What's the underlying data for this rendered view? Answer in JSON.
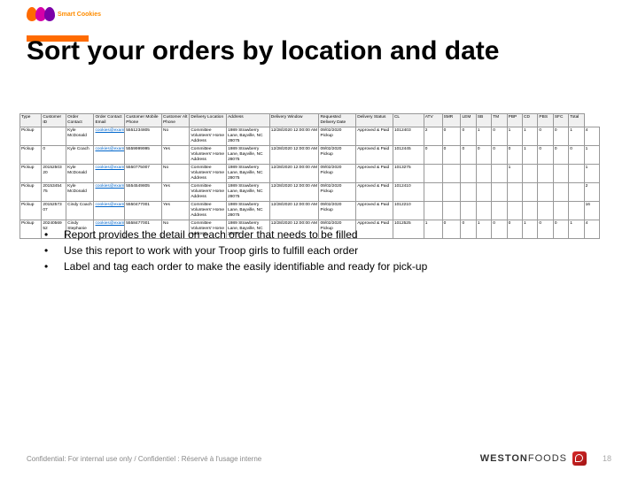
{
  "logo_text": "Smart Cookies",
  "title": "Sort your orders by location and date",
  "table": {
    "headers": [
      "Type",
      "Customer ID",
      "Order Contact",
      "Order Contact Email",
      "Customer Mobile Phone",
      "Customer Alt Phone",
      "Delivery Location",
      "Address",
      "Delivery Window",
      "Requested Delivery Date",
      "Delivery Status",
      "CL",
      "ATV",
      "SMR",
      "LEM",
      "SB",
      "TM",
      "PBP",
      "CD",
      "PBS",
      "SFC",
      "Total"
    ],
    "rows": [
      {
        "c": [
          "Pickup",
          "",
          "Kyle McDonald",
          "cookies@example.com",
          "5551234805",
          "No",
          "Committee Volunteers' Home Address",
          "1989 Strawberry Lane, Bayville, NC 28075",
          "12/28/2020 12:00:00 AM",
          "09/02/2020 Pickup",
          "Approved & Paid",
          "1012403",
          "2",
          "0",
          "0",
          "1",
          "0",
          "1",
          "1",
          "0",
          "0",
          "1",
          "4"
        ]
      },
      {
        "c": [
          "Pickup",
          "0",
          "Kyle Coach",
          "cookies@example.com",
          "5559999995",
          "Yes",
          "Committee Volunteers' Home Address",
          "1989 Strawberry Lane, Bayville, NC 28075",
          "12/28/2020 12:00:00 AM",
          "09/02/2020 Pickup",
          "Approved & Paid",
          "1012445",
          "0",
          "0",
          "0",
          "0",
          "0",
          "0",
          "1",
          "0",
          "0",
          "0",
          "1"
        ]
      },
      {
        "c": [
          "Pickup",
          "20152503 20",
          "Kyle McDonald",
          "cookies@example.com",
          "5550775007",
          "No",
          "Committee Volunteers' Home Address",
          "1989 Strawberry Lane, Bayville, NC 28075",
          "12/28/2020 12:00:00 AM",
          "09/02/2020 Pickup",
          "Approved & Paid",
          "1013275",
          "",
          "",
          "",
          "",
          "",
          "1",
          "",
          "",
          "",
          "",
          "1"
        ]
      },
      {
        "c": [
          "Pickup",
          "20153454 75",
          "Kyle McDonald",
          "cookies@example.com",
          "5554549805",
          "Yes",
          "Committee Volunteers' Home Address",
          "1989 Strawberry Lane, Bayville, NC 28075",
          "12/28/2020 12:00:00 AM",
          "09/02/2020 Pickup",
          "Approved & Paid",
          "1012410",
          "",
          "",
          "",
          "",
          "",
          "",
          "",
          "",
          "",
          "",
          "2"
        ]
      },
      {
        "c": [
          "Pickup",
          "20152573 07",
          "Cindy Coach",
          "cookies@example.com",
          "5550477001",
          "Yes",
          "Committee Volunteers' Home Address",
          "1989 Strawberry Lane, Bayville, NC 28075",
          "12/28/2020 12:00:00 AM",
          "09/02/2020 Pickup",
          "Approved & Paid",
          "1012210",
          "",
          "",
          "",
          "",
          "",
          "",
          "",
          "",
          "",
          "",
          "16"
        ]
      },
      {
        "c": [
          "Pickup",
          "20240569 52",
          "Cindy Stephanie",
          "cookies@example.com",
          "5558477001",
          "No",
          "Committee Volunteers' Home Address",
          "1989 Strawberry Lane, Bayville, NC 28075",
          "12/28/2020 12:00:00 AM",
          "09/02/2020 Pickup",
          "Approved & Paid",
          "1012525",
          "1",
          "0",
          "0",
          "1",
          "0",
          "0",
          "1",
          "0",
          "0",
          "1",
          "4"
        ]
      }
    ]
  },
  "bullets": [
    "Report provides the detail on each order that needs to be filled",
    "Use this report to work with your Troop girls to fulfill each order",
    "Label and tag each order to make the easily identifiable and ready for pick-up"
  ],
  "footer": {
    "confidential": "Confidential: For internal use only / Confidentiel : Réservé à l'usage interne",
    "brand_a": "WESTON",
    "brand_b": "FOODS",
    "page": "18"
  }
}
